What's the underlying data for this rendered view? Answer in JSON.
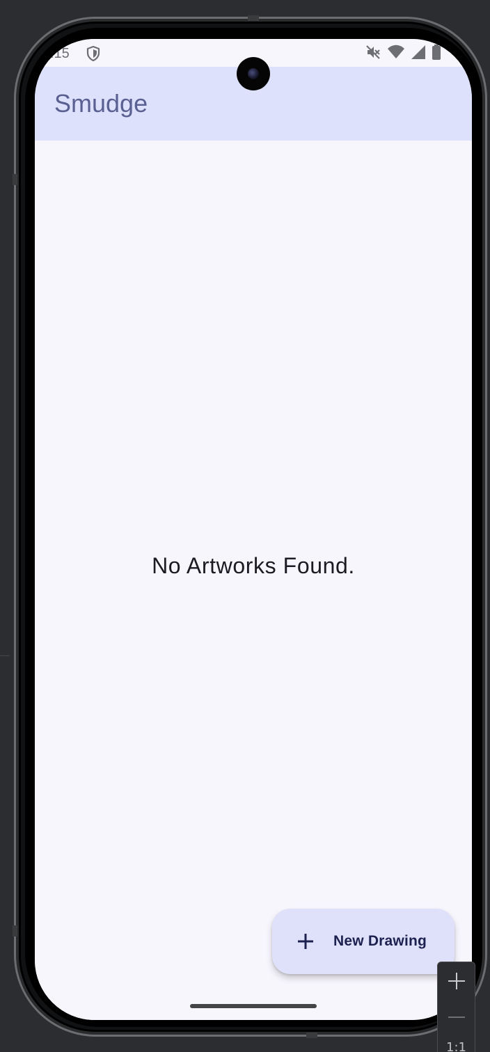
{
  "status_bar": {
    "time": ":15",
    "left_icon": "shield-icon",
    "right_icons": [
      "mute-icon",
      "wifi-icon",
      "signal-icon",
      "battery-icon"
    ]
  },
  "app_bar": {
    "title": "Smudge",
    "background_color": "#dde1fb",
    "title_color": "#5a6192"
  },
  "main": {
    "empty_message": "No Artworks Found."
  },
  "fab": {
    "icon": "plus-icon",
    "label": "New Drawing",
    "background_color": "#dfe1fa"
  },
  "emulator_zoom": {
    "zoom_in_icon": "plus-icon",
    "zoom_out_icon": "minus-icon",
    "ratio_label": "1:1"
  }
}
